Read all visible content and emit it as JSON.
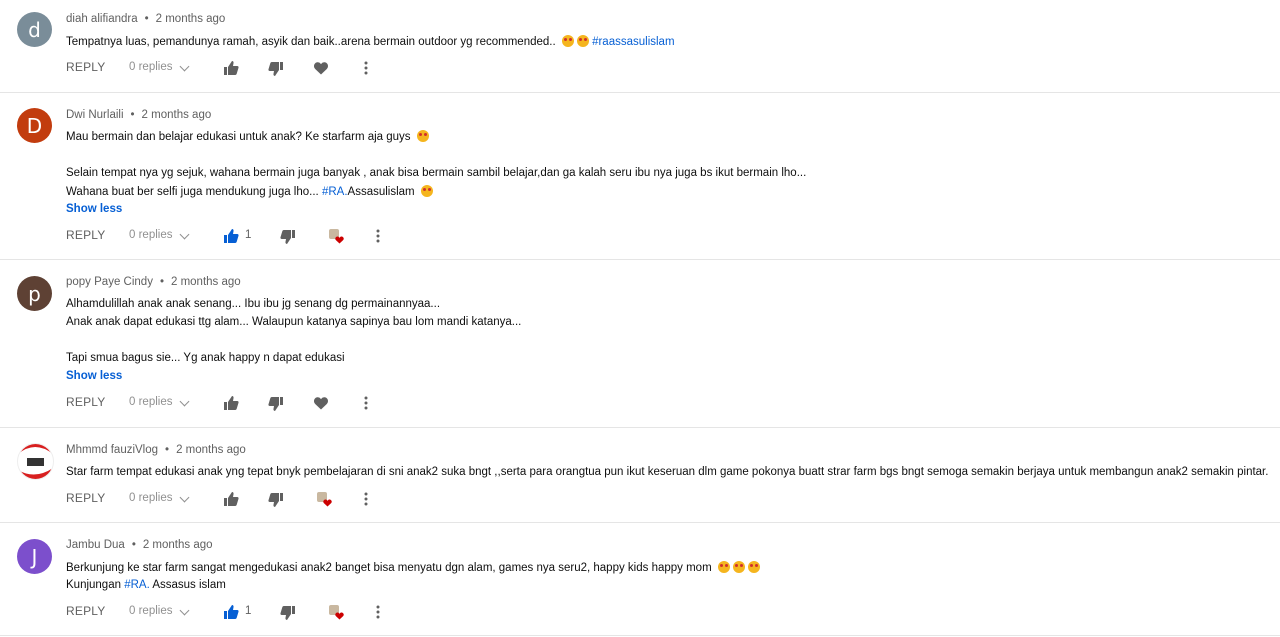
{
  "colors": {
    "link": "#065fd4",
    "like_active": "#065fd4"
  },
  "labels": {
    "reply": "REPLY",
    "show_less": "Show less"
  },
  "comments": [
    {
      "author": "diah alifiandra",
      "time": "2 months ago",
      "avatar_letter": "d",
      "avatar_color": "#7a8d99",
      "lines": [
        "Tempatnya luas, pemandunya ramah, asyik dan baik..arena bermain outdoor yg recommended.."
      ],
      "hashtag": "#raassasulislam",
      "replies": "0 replies",
      "likes": "",
      "heart": "heart-icon"
    },
    {
      "author": "Dwi Nurlaili",
      "time": "2 months ago",
      "avatar_letter": "D",
      "avatar_color": "#c23c0e",
      "lines": [
        "Mau bermain dan belajar edukasi untuk anak? Ke starfarm aja guys",
        "Selain tempat nya yg sejuk, wahana bermain juga banyak , anak bisa bermain sambil belajar,dan ga kalah seru ibu nya juga bs ikut bermain lho...",
        "Wahana buat ber selfi juga mendukung juga lho..."
      ],
      "hashtag": "#RA.",
      "hashtag_tail": "Assasulislam",
      "show_less": "Show less",
      "replies": "0 replies",
      "likes": "1",
      "heart": "creator-heart-icon"
    },
    {
      "author": "popy Paye Cindy",
      "time": "2 months ago",
      "avatar_letter": "p",
      "avatar_color": "#5e4134",
      "lines": [
        "Alhamdulillah anak anak senang... Ibu ibu jg senang dg permainannyaa...",
        "Anak anak dapat edukasi ttg alam... Walaupun katanya sapinya bau lom mandi katanya...",
        "Tapi smua bagus sie... Yg anak happy n dapat edukasi"
      ],
      "show_less": "Show less",
      "replies": "0 replies",
      "likes": "",
      "heart": "heart-icon"
    },
    {
      "author": "Mhmmd fauziVlog",
      "time": "2 months ago",
      "avatar_letter": "",
      "avatar_color": "#ffffff",
      "lines": [
        "Star farm tempat edukasi anak yng tepat bnyk pembelajaran di sni anak2 suka bngt ,,serta para orangtua pun ikut keseruan dlm game pokonya buatt strar farm bgs bngt semoga semakin berjaya untuk membangun anak2 semakin pintar."
      ],
      "replies": "0 replies",
      "likes": "",
      "heart": "creator-heart-icon"
    },
    {
      "author": "Jambu Dua",
      "time": "2 months ago",
      "avatar_letter": "J",
      "avatar_color": "#7c4fcc",
      "lines": [
        "Berkunjung ke star farm sangat mengedukasi anak2 banget bisa menyatu dgn alam, games nya seru2, happy kids happy mom",
        "Kunjungan"
      ],
      "hashtag": "#RA.",
      "hashtag_tail": "Assasus islam",
      "replies": "0 replies",
      "likes": "1",
      "heart": "creator-heart-icon"
    }
  ]
}
